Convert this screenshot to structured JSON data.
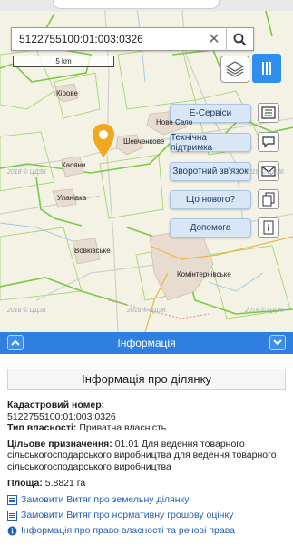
{
  "search": {
    "value": "5122755100:01:003:0326",
    "placeholder": ""
  },
  "scale": {
    "label": "5 km"
  },
  "menu": {
    "items": [
      {
        "label": "Е-Сервіси",
        "icon": "book-icon"
      },
      {
        "label": "Технічна підтримка",
        "icon": "chat-icon"
      },
      {
        "label": "Зворотний зв'язок",
        "icon": "mail-icon"
      },
      {
        "label": "Що нового?",
        "icon": "documents-icon"
      },
      {
        "label": "Допомога",
        "icon": "info-icon"
      }
    ]
  },
  "map": {
    "places": [
      "Кірове",
      "Нове Село",
      "Шевченкове",
      "Касяни",
      "Уланівка",
      "Вовківське",
      "Комінтернівське"
    ],
    "watermark": "2018 © ЦДЗК"
  },
  "info": {
    "header": "Інформація",
    "title": "Інформація про ділянку",
    "cadastral_label": "Кадастровий номер:",
    "cadastral_value": "5122755100:01:003:0326",
    "ownership_label": "Тип власності:",
    "ownership_value": "Приватна власність",
    "purpose_label": "Цільове призначення:",
    "purpose_value": "01.01 Для ведення товарного сільськогосподарського виробництва для ведення товарного сільськогосподарського виробництва",
    "area_label": "Площа:",
    "area_value": "5.8821 га",
    "links": [
      {
        "label": "Замовити Витяг про земельну ділянку",
        "icon": "document-icon"
      },
      {
        "label": "Замовити Витяг про нормативну грошову оцінку",
        "icon": "document-icon"
      },
      {
        "label": "Інформація про право власності та речові права",
        "icon": "info-icon"
      }
    ]
  },
  "colors": {
    "accent": "#2e7fe0",
    "menu_button": "#2e8ff0",
    "marker": "#f0a81e",
    "parcel_border": "#7bbf3a",
    "district_border": "#7ac943"
  }
}
